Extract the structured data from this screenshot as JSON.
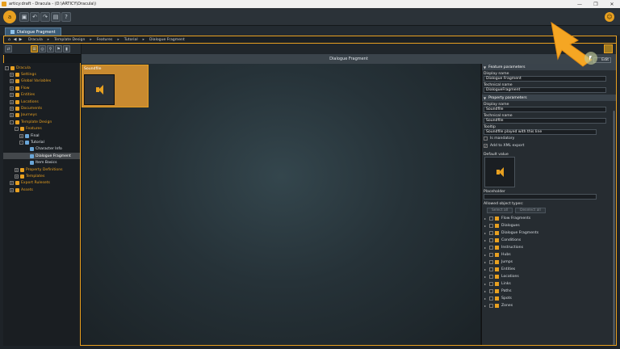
{
  "window": {
    "title": "articy:draft - Dracula - (D:\\ARTICY\\Dracula\\)",
    "minimize": "—",
    "maximize": "❐",
    "close": "✕"
  },
  "toolbar": {
    "logo": "a",
    "save": "▣",
    "undo": "↶",
    "redo": "↷",
    "nav": "▤",
    "help": "?",
    "user": "☺"
  },
  "tab": {
    "label": "Dialogue Fragment"
  },
  "breadcrumb": {
    "home": "⌂",
    "back": "◀",
    "forward": "▶",
    "items": [
      "Dracula",
      "Template Design",
      "Features",
      "Tutorial",
      "Dialogue Fragment"
    ],
    "sep": "▸"
  },
  "left_toolbar": {
    "b1": "⇄",
    "b2": "⊞",
    "b3": "◎",
    "b4": "⚲",
    "b5": "⚑",
    "b6": "▮"
  },
  "tree": [
    {
      "label": "Dracula",
      "indent": 0,
      "style": "orange",
      "tog": "-"
    },
    {
      "label": "Settings",
      "indent": 1,
      "style": "orange",
      "tog": "+"
    },
    {
      "label": "Global Variables",
      "indent": 1,
      "style": "orange",
      "tog": "+"
    },
    {
      "label": "Flow",
      "indent": 1,
      "style": "orange",
      "tog": "+"
    },
    {
      "label": "Entities",
      "indent": 1,
      "style": "orange",
      "tog": "+"
    },
    {
      "label": "Locations",
      "indent": 1,
      "style": "orange",
      "tog": "+"
    },
    {
      "label": "Documents",
      "indent": 1,
      "style": "orange",
      "tog": "+"
    },
    {
      "label": "Journeys",
      "indent": 1,
      "style": "orange",
      "tog": "+"
    },
    {
      "label": "Template Design",
      "indent": 1,
      "style": "orange",
      "tog": "-"
    },
    {
      "label": "Features",
      "indent": 2,
      "style": "orange",
      "tog": "-"
    },
    {
      "label": "Final",
      "indent": 3,
      "style": "white",
      "tog": "+"
    },
    {
      "label": "Tutorial",
      "indent": 3,
      "style": "white",
      "tog": "-"
    },
    {
      "label": "Character Info",
      "indent": 4,
      "style": "white",
      "tog": ""
    },
    {
      "label": "Dialogue Fragment",
      "indent": 4,
      "style": "selected",
      "tog": ""
    },
    {
      "label": "Item Basics",
      "indent": 4,
      "style": "white",
      "tog": ""
    },
    {
      "label": "Property Definitions",
      "indent": 2,
      "style": "orange",
      "tog": "+"
    },
    {
      "label": "Templates",
      "indent": 2,
      "style": "orange",
      "tog": "+"
    },
    {
      "label": "Export Rulesets",
      "indent": 1,
      "style": "orange",
      "tog": "+"
    },
    {
      "label": "Assets",
      "indent": 1,
      "style": "orange",
      "tog": "+"
    }
  ],
  "canvas": {
    "header": "Dialogue Fragment",
    "node_title": "Soundfile"
  },
  "props": {
    "edit_button": "Edit",
    "feature_section": "Feature parameters",
    "display_name_label": "Display name",
    "display_name_value": "Dialogue Fragment",
    "technical_name_label": "Technical name",
    "technical_name_value": "DialogueFragment",
    "property_section": "Property parameters",
    "p_display_name_label": "Display name",
    "p_display_name_value": "Soundfile",
    "p_technical_name_label": "Technical name",
    "p_technical_name_value": "Soundfile",
    "tooltip_label": "Tooltip",
    "tooltip_value": "Soundfile played with this line",
    "is_mandatory": "Is mandatory",
    "add_to_xml": "Add to XML export",
    "default_value_label": "Default value",
    "placeholder_label": "Placeholder",
    "allowed_types_label": "Allowed object types:",
    "select_all": "Select all",
    "deselect_all": "Deselect all",
    "object_types": [
      "Flow Fragments",
      "Dialogues",
      "Dialogue Fragments",
      "Conditions",
      "Instructions",
      "Hubs",
      "Jumps",
      "Entities",
      "Locations",
      "Links",
      "Paths",
      "Spots",
      "Zones"
    ]
  },
  "colors": {
    "accent": "#e8a020",
    "selection": "#44484c",
    "panel": "#262c31"
  }
}
